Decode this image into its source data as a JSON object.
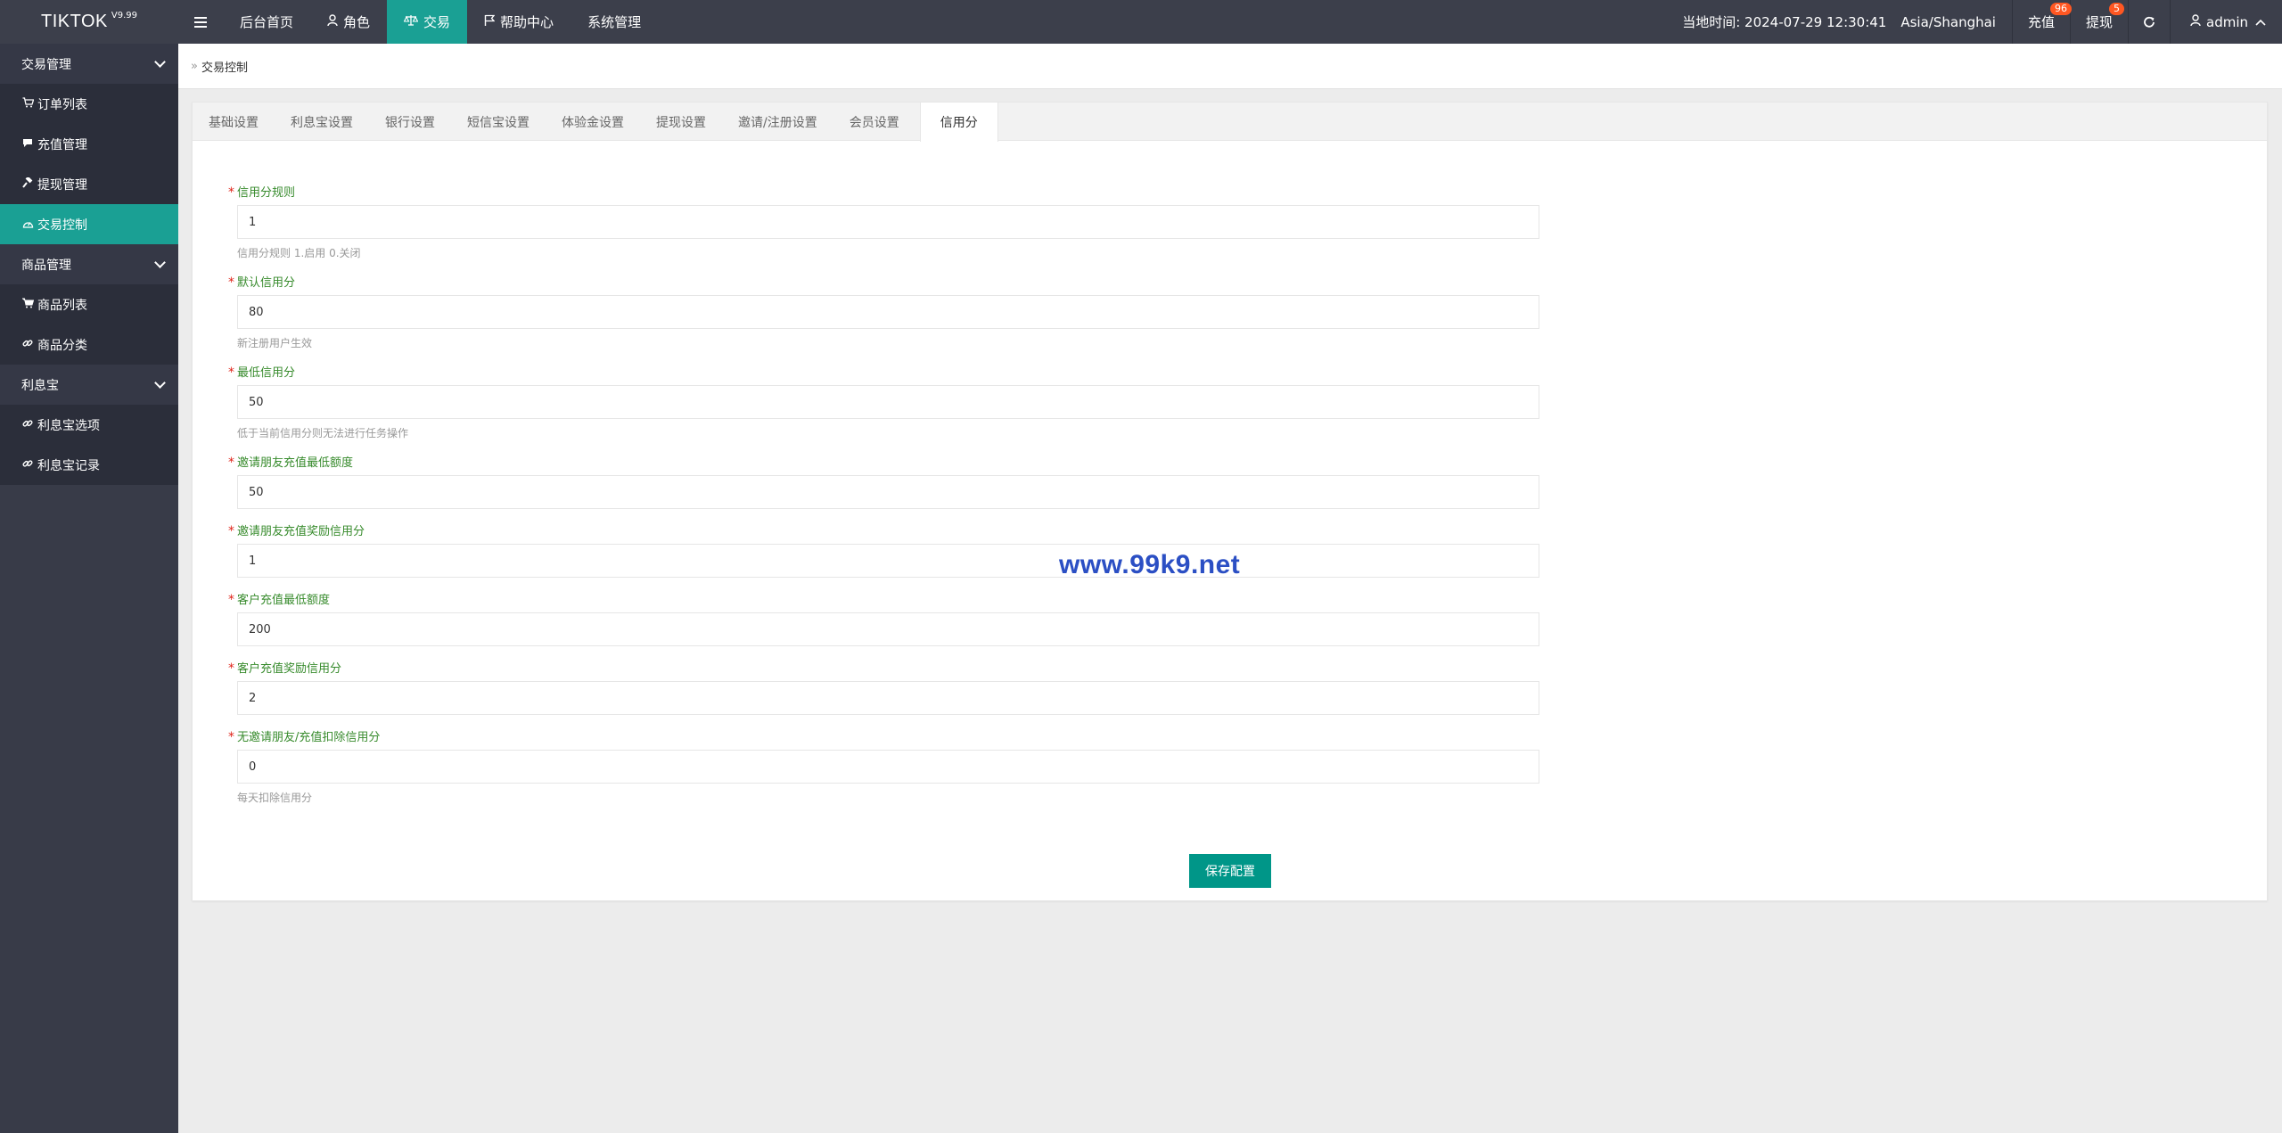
{
  "app": {
    "name": "TIKTOK",
    "version": "V9.99"
  },
  "nav": [
    {
      "label": "后台首页",
      "icon": ""
    },
    {
      "label": "角色",
      "icon": "user-icon"
    },
    {
      "label": "交易",
      "icon": "scale-icon",
      "active": true
    },
    {
      "label": "帮助中心",
      "icon": "flag-icon"
    },
    {
      "label": "系统管理",
      "icon": ""
    }
  ],
  "header": {
    "time_label": "当地时间: 2024-07-29 12:30:41",
    "timezone": "Asia/Shanghai",
    "recharge": {
      "label": "充值",
      "badge": "96"
    },
    "withdraw": {
      "label": "提现",
      "badge": "5"
    },
    "user": "admin"
  },
  "sidebar": {
    "groups": [
      {
        "label": "交易管理",
        "items": [
          {
            "label": "订单列表",
            "icon": "cart-icon"
          },
          {
            "label": "充值管理",
            "icon": "comment-icon"
          },
          {
            "label": "提现管理",
            "icon": "hammer-icon"
          },
          {
            "label": "交易控制",
            "icon": "dashboard-icon",
            "active": true
          }
        ]
      },
      {
        "label": "商品管理",
        "items": [
          {
            "label": "商品列表",
            "icon": "cart-icon"
          },
          {
            "label": "商品分类",
            "icon": "link-icon"
          }
        ]
      },
      {
        "label": "利息宝",
        "items": [
          {
            "label": "利息宝选项",
            "icon": "link-icon"
          },
          {
            "label": "利息宝记录",
            "icon": "link-icon"
          }
        ]
      }
    ]
  },
  "breadcrumb": {
    "current": "交易控制"
  },
  "tabs": [
    "基础设置",
    "利息宝设置",
    "银行设置",
    "短信宝设置",
    "体验金设置",
    "提现设置",
    "邀请/注册设置",
    "会员设置",
    "信用分"
  ],
  "form": {
    "fields": [
      {
        "label": "信用分规则",
        "value": "1",
        "help": "信用分规则 1.启用 0.关闭"
      },
      {
        "label": "默认信用分",
        "value": "80",
        "help": "新注册用户生效"
      },
      {
        "label": "最低信用分",
        "value": "50",
        "help": "低于当前信用分则无法进行任务操作"
      },
      {
        "label": "邀请朋友充值最低额度",
        "value": "50",
        "help": ""
      },
      {
        "label": "邀请朋友充值奖励信用分",
        "value": "1",
        "help": ""
      },
      {
        "label": "客户充值最低额度",
        "value": "200",
        "help": ""
      },
      {
        "label": "客户充值奖励信用分",
        "value": "2",
        "help": ""
      },
      {
        "label": "无邀请朋友/充值扣除信用分",
        "value": "0",
        "help": "每天扣除信用分"
      }
    ],
    "save_label": "保存配置"
  },
  "watermark": "www.99k9.net",
  "colors": {
    "accent": "#009688",
    "header_bg": "#3c3f4b",
    "sidebar_bg": "#2b2e3a",
    "label_green": "#378b2c"
  }
}
